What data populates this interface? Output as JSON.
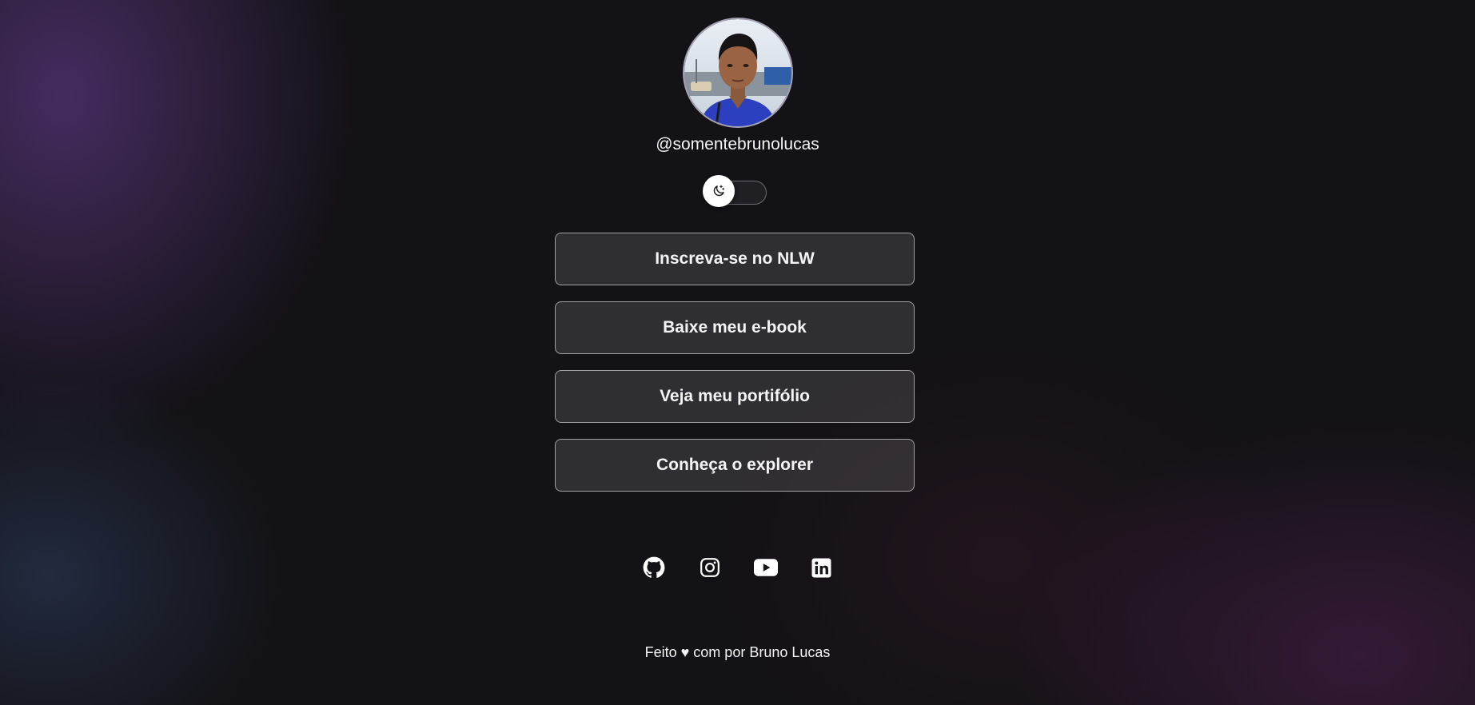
{
  "profile": {
    "username": "@somentebrunolucas",
    "avatar_alt": "Foto de perfil"
  },
  "theme_switch": {
    "icon": "moon-icon"
  },
  "links": [
    {
      "label": "Inscreva-se no NLW"
    },
    {
      "label": "Baixe meu e-book"
    },
    {
      "label": "Veja meu portifólio"
    },
    {
      "label": "Conheça o explorer"
    }
  ],
  "social": [
    {
      "icon": "github-icon"
    },
    {
      "icon": "instagram-icon"
    },
    {
      "icon": "youtube-icon"
    },
    {
      "icon": "linkedin-icon"
    }
  ],
  "footer": {
    "text": "Feito ♥ com por Bruno Lucas"
  },
  "colors": {
    "background": "#131216",
    "accent_purple": "#563478",
    "text": "#f4f4f5",
    "button_border": "#8c8c94"
  }
}
